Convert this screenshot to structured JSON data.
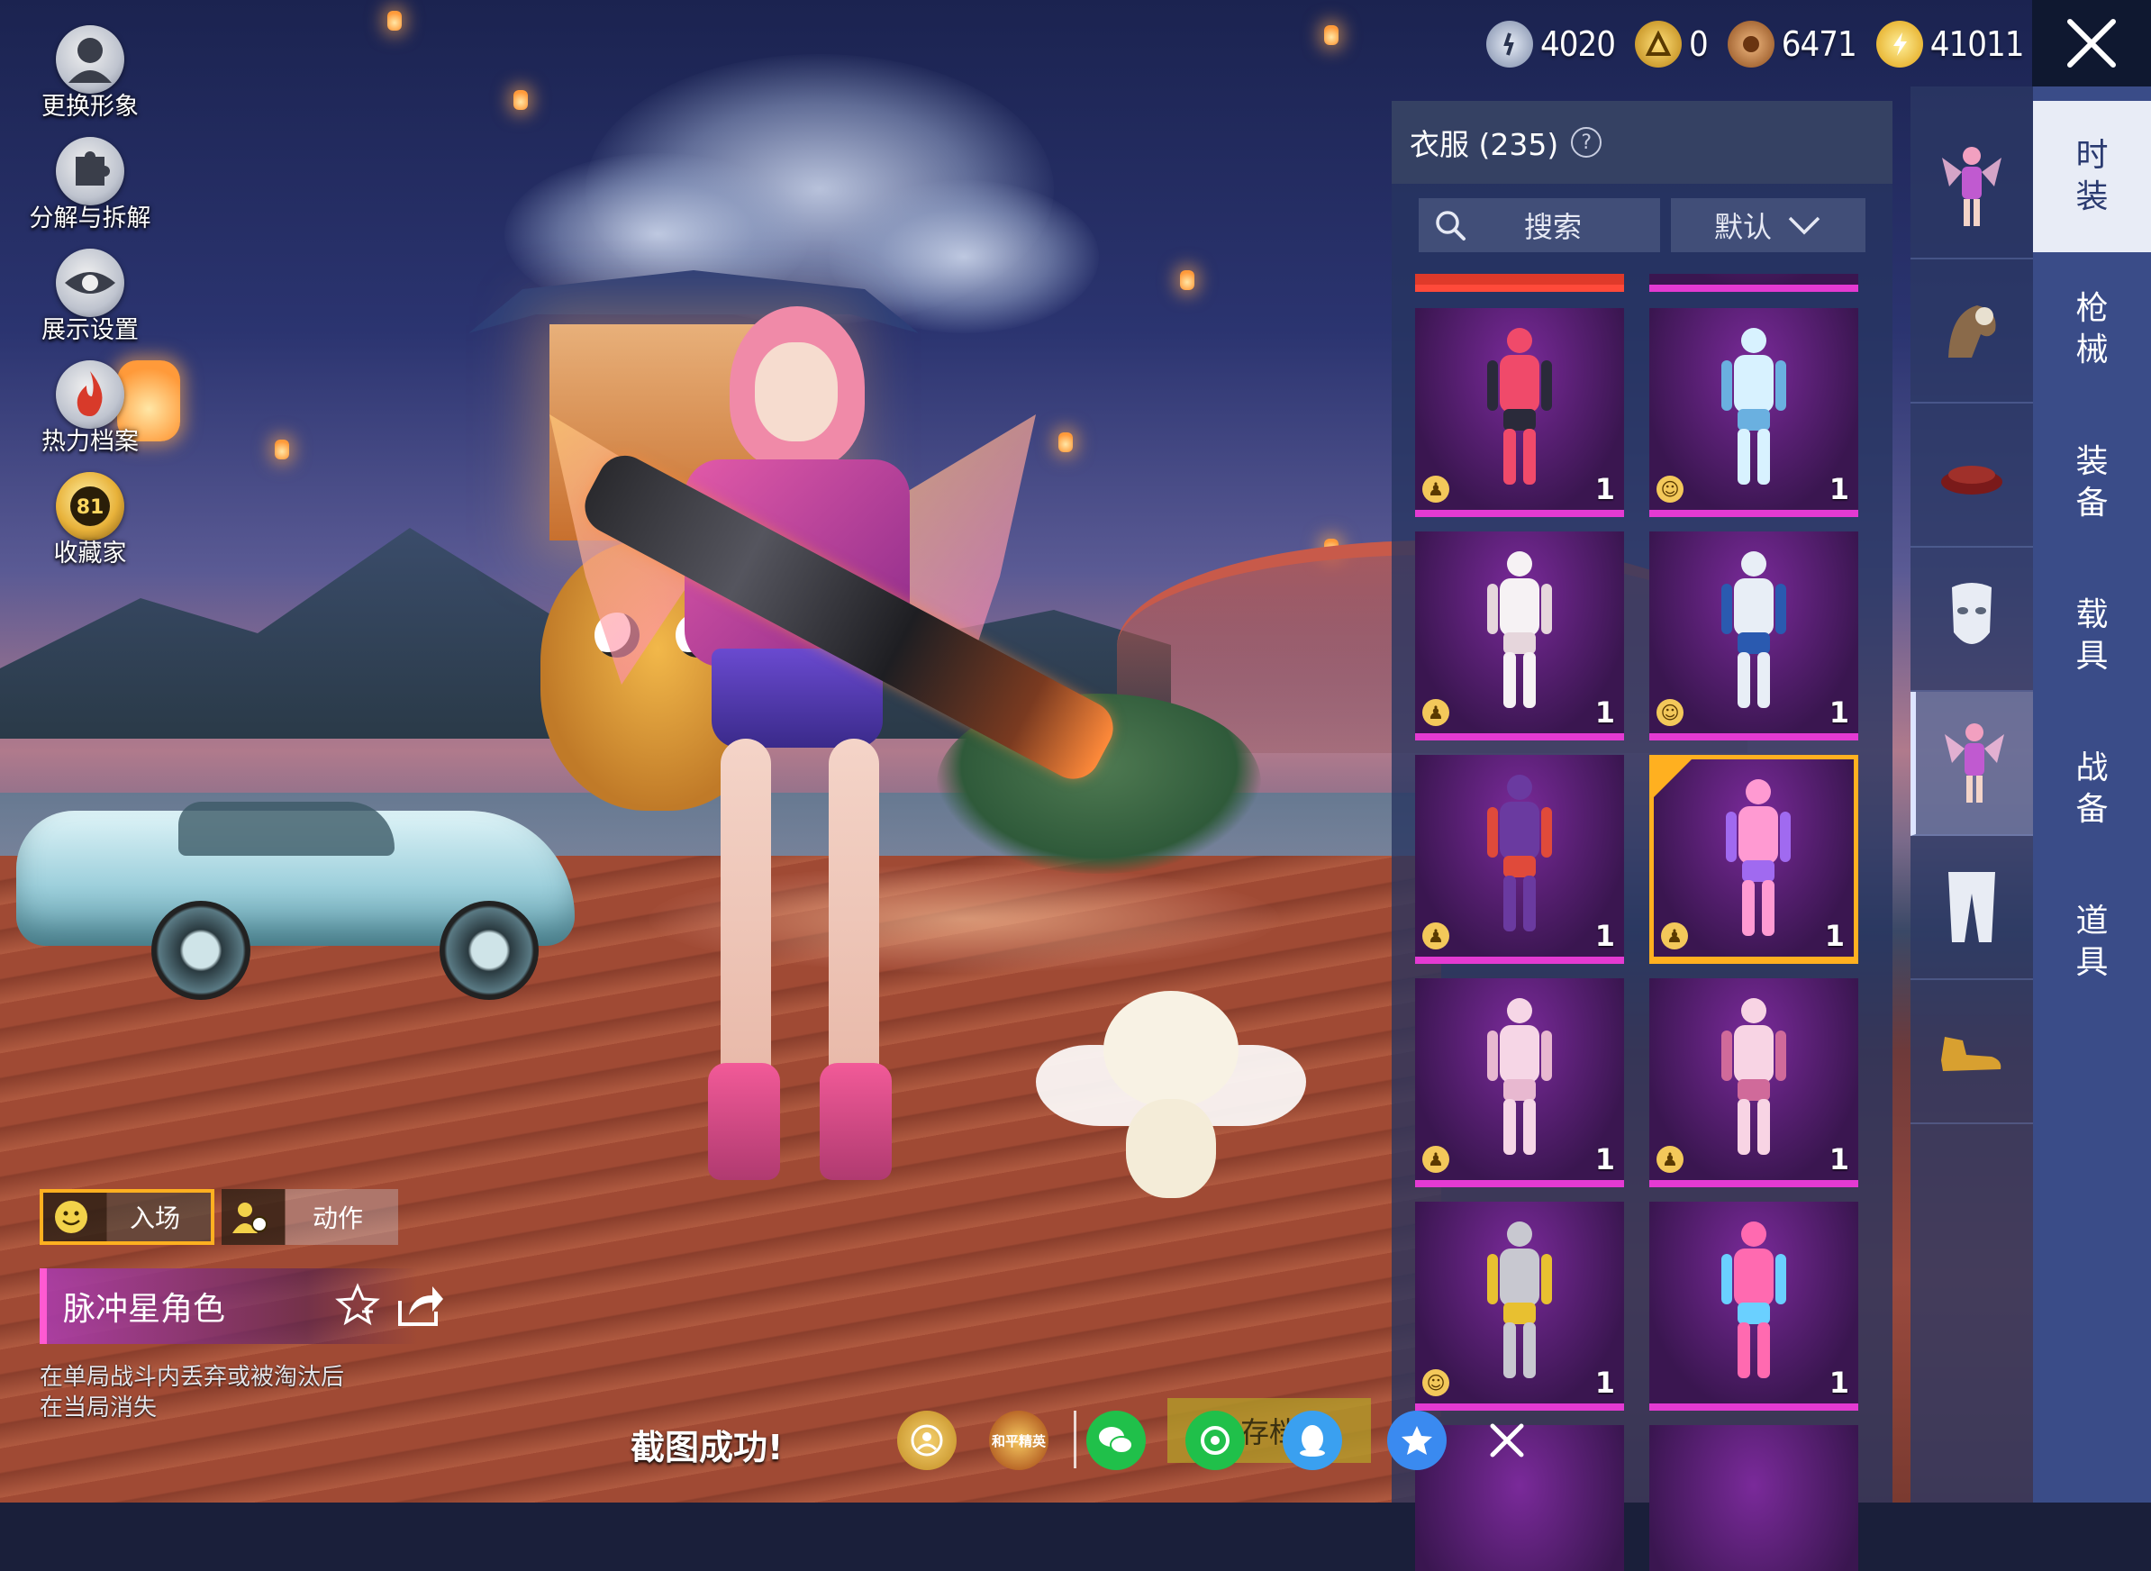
{
  "left_menu": [
    {
      "label": "更换形象",
      "icon": "avatar-icon"
    },
    {
      "label": "分解与拆解",
      "icon": "puzzle-icon"
    },
    {
      "label": "展示设置",
      "icon": "eye-icon"
    },
    {
      "label": "热力档案",
      "icon": "flame-icon"
    },
    {
      "label": "收藏家",
      "icon": "collector-badge-icon",
      "badge": "81"
    }
  ],
  "currencies": [
    {
      "icon": "silver-coin-icon",
      "value": "4020",
      "color": "#7c8aa8"
    },
    {
      "icon": "gold-emblem-icon",
      "value": "0",
      "color": "#d2a22a"
    },
    {
      "icon": "bronze-coin-icon",
      "value": "6471",
      "color": "#b8743a"
    },
    {
      "icon": "lightning-coin-icon",
      "value": "41011",
      "color": "#f0c020"
    }
  ],
  "panel": {
    "title": "衣服 (235)",
    "search_label": "搜索",
    "sort_label": "默认"
  },
  "items": [
    {
      "name": "outfit-harley",
      "qty": "1",
      "tag": "person",
      "palette": [
        "#f04a6a",
        "#2a2a3a"
      ]
    },
    {
      "name": "outfit-ice-armor",
      "qty": "1",
      "tag": "smile",
      "palette": [
        "#d8f2ff",
        "#6ab0e0"
      ]
    },
    {
      "name": "outfit-white-angel",
      "qty": "1",
      "tag": "person",
      "palette": [
        "#f6f2f4",
        "#e6d6dc"
      ]
    },
    {
      "name": "outfit-mech-suit",
      "qty": "1",
      "tag": "smile",
      "palette": [
        "#e8eef6",
        "#2a5ab0"
      ]
    },
    {
      "name": "outfit-eva-plugsuit",
      "qty": "1",
      "tag": "person",
      "palette": [
        "#6a3aa0",
        "#e04a3a"
      ]
    },
    {
      "name": "outfit-pulse-star",
      "qty": "1",
      "tag": "person",
      "palette": [
        "#ff9ad2",
        "#a06af0"
      ],
      "selected": true
    },
    {
      "name": "outfit-pink-gown",
      "qty": "1",
      "tag": "person",
      "palette": [
        "#f6d6e6",
        "#e8b8d0"
      ]
    },
    {
      "name": "outfit-pink-dress",
      "qty": "1",
      "tag": "person",
      "palette": [
        "#f8d4e4",
        "#d06a9a"
      ]
    },
    {
      "name": "outfit-gold-suit",
      "qty": "1",
      "tag": "smile",
      "palette": [
        "#c8c8d0",
        "#e8c030"
      ]
    },
    {
      "name": "outfit-rainbow-set",
      "qty": "1",
      "tag": "",
      "palette": [
        "#ff6ab0",
        "#6ad0ff"
      ]
    }
  ],
  "right_tabs": [
    {
      "label": [
        "时",
        "装"
      ],
      "active": true
    },
    {
      "label": [
        "枪",
        "械"
      ]
    },
    {
      "label": [
        "装",
        "备"
      ]
    },
    {
      "label": [
        "载",
        "具"
      ]
    },
    {
      "label": [
        "战",
        "备"
      ]
    },
    {
      "label": [
        "道",
        "具"
      ]
    }
  ],
  "category_thumbs": [
    {
      "name": "cat-outfit"
    },
    {
      "name": "cat-headwear"
    },
    {
      "name": "cat-hat"
    },
    {
      "name": "cat-mask"
    },
    {
      "name": "cat-suit",
      "active": true
    },
    {
      "name": "cat-pants"
    },
    {
      "name": "cat-shoes"
    }
  ],
  "bottom": {
    "entry_label": "入场",
    "action_label": "动作",
    "set_name": "脉冲星角色",
    "note_line1": "在单局战斗内丢弃或被淘汰后",
    "note_line2": "在当局消失",
    "screenshot_ok": "截图成功!",
    "save_label": "存档",
    "peace_elite_label": "和平精英"
  }
}
